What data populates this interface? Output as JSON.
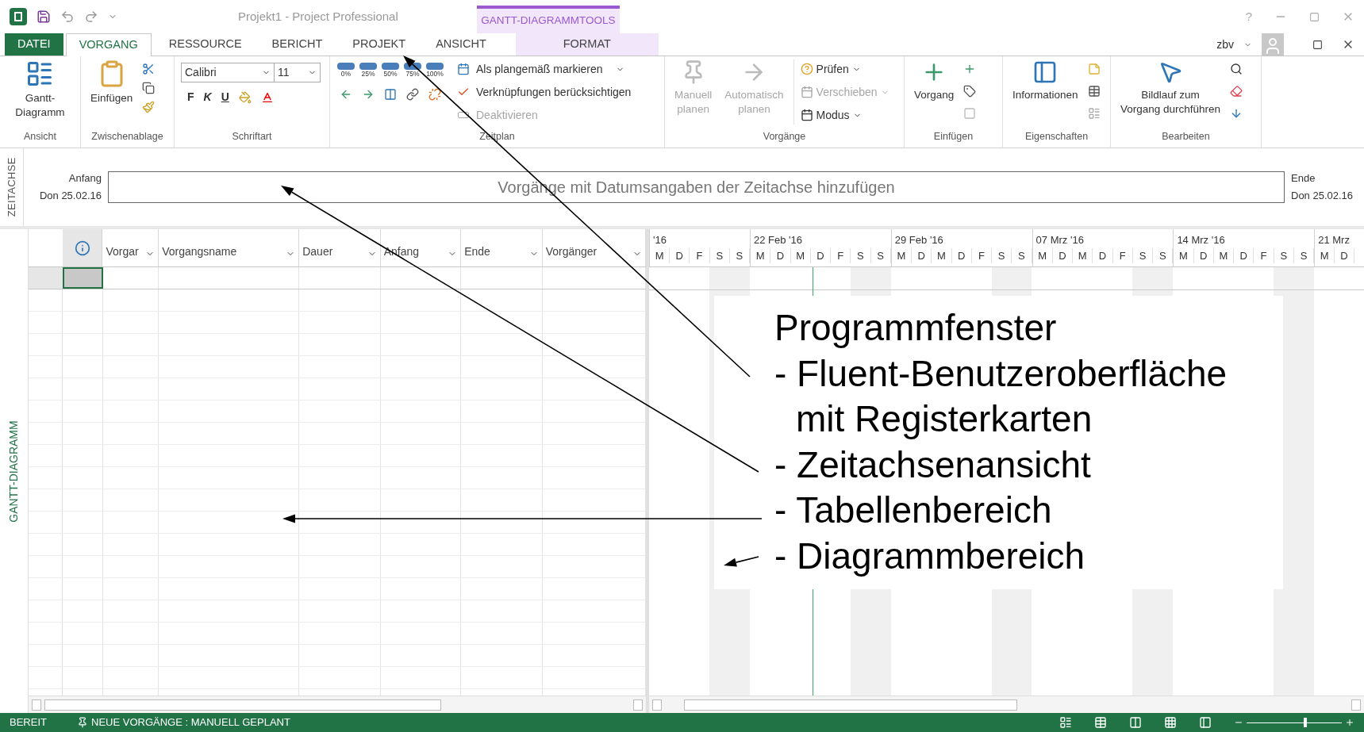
{
  "titlebar": {
    "title": "Projekt1 - Project Professional",
    "context_tab": "GANTT-DIAGRAMMTOOLS",
    "help": "?",
    "user": "zbv"
  },
  "tabs": [
    {
      "label": "DATEI",
      "kind": "file",
      "selected": false
    },
    {
      "label": "VORGANG",
      "kind": "tab",
      "selected": true
    },
    {
      "label": "RESSOURCE",
      "kind": "tab",
      "selected": false
    },
    {
      "label": "BERICHT",
      "kind": "tab",
      "selected": false
    },
    {
      "label": "PROJEKT",
      "kind": "tab",
      "selected": false
    },
    {
      "label": "ANSICHT",
      "kind": "tab",
      "selected": false
    },
    {
      "label": "FORMAT",
      "kind": "context",
      "selected": false
    }
  ],
  "ribbon": {
    "view": {
      "group": "Ansicht",
      "button": [
        "Gantt-",
        "Diagramm"
      ]
    },
    "clipboard": {
      "group": "Zwischenablage",
      "paste": "Einfügen"
    },
    "font": {
      "group": "Schriftart",
      "family": "Calibri",
      "size": "11",
      "bold": "F",
      "italic": "K",
      "underline": "U"
    },
    "schedule": {
      "group": "Zeitplan",
      "percents": [
        "0%",
        "25%",
        "50%",
        "75%",
        "100%"
      ],
      "commands": [
        {
          "label": "Als plangemäß markieren",
          "disabled": false,
          "dropdown": true
        },
        {
          "label": "Verknüpfungen berücksichtigen",
          "disabled": false,
          "dropdown": false
        },
        {
          "label": "Deaktivieren",
          "disabled": true,
          "dropdown": false
        }
      ]
    },
    "tasks": {
      "group": "Vorgänge",
      "big": [
        {
          "label": [
            "Manuell",
            "planen"
          ],
          "disabled": true
        },
        {
          "label": [
            "Automatisch",
            "planen"
          ],
          "disabled": true
        }
      ],
      "commands": [
        {
          "label": "Prüfen",
          "disabled": false
        },
        {
          "label": "Verschieben",
          "disabled": true
        },
        {
          "label": "Modus",
          "disabled": false
        }
      ]
    },
    "insert": {
      "group": "Einfügen",
      "button": "Vorgang"
    },
    "properties": {
      "group": "Eigenschaften",
      "button": "Informationen"
    },
    "editing": {
      "group": "Bearbeiten",
      "button": [
        "Bildlauf zum",
        "Vorgang durchführen"
      ]
    }
  },
  "timeline": {
    "side_label": "ZEITACHSE",
    "start_label": "Anfang",
    "start_date": "Don 25.02.16",
    "hint": "Vorgänge mit Datumsangaben der Zeitachse hinzufügen",
    "end_label": "Ende",
    "end_date": "Don 25.02.16"
  },
  "table": {
    "side_label": "GANTT-DIAGRAMM",
    "columns": [
      {
        "label": "Vorgar"
      },
      {
        "label": "Vorgangsname"
      },
      {
        "label": "Dauer"
      },
      {
        "label": "Anfang"
      },
      {
        "label": "Ende"
      },
      {
        "label": "Vorgänger"
      }
    ],
    "rows": [
      {
        "selected": true
      }
    ]
  },
  "gantt": {
    "weeks": [
      {
        "label": "'16",
        "days": [
          {
            "label": "M",
            "shaded": false
          },
          {
            "label": "D",
            "shaded": false
          },
          {
            "label": "F",
            "shaded": false
          },
          {
            "label": "S",
            "shaded": true
          },
          {
            "label": "S",
            "shaded": true
          }
        ]
      },
      {
        "label": "22 Feb '16",
        "days": [
          {
            "label": "M",
            "shaded": false
          },
          {
            "label": "D",
            "shaded": false
          },
          {
            "label": "M",
            "shaded": false
          },
          {
            "label": "D",
            "shaded": false
          },
          {
            "label": "F",
            "shaded": false
          },
          {
            "label": "S",
            "shaded": true
          },
          {
            "label": "S",
            "shaded": true
          }
        ]
      },
      {
        "label": "29 Feb '16",
        "days": [
          {
            "label": "M",
            "shaded": false
          },
          {
            "label": "D",
            "shaded": false
          },
          {
            "label": "M",
            "shaded": false
          },
          {
            "label": "D",
            "shaded": false
          },
          {
            "label": "F",
            "shaded": false
          },
          {
            "label": "S",
            "shaded": true
          },
          {
            "label": "S",
            "shaded": true
          }
        ]
      },
      {
        "label": "07 Mrz '16",
        "days": [
          {
            "label": "M",
            "shaded": false
          },
          {
            "label": "D",
            "shaded": false
          },
          {
            "label": "M",
            "shaded": false
          },
          {
            "label": "D",
            "shaded": false
          },
          {
            "label": "F",
            "shaded": false
          },
          {
            "label": "S",
            "shaded": true
          },
          {
            "label": "S",
            "shaded": true
          }
        ]
      },
      {
        "label": "14 Mrz '16",
        "days": [
          {
            "label": "M",
            "shaded": false
          },
          {
            "label": "D",
            "shaded": false
          },
          {
            "label": "M",
            "shaded": false
          },
          {
            "label": "D",
            "shaded": false
          },
          {
            "label": "F",
            "shaded": false
          },
          {
            "label": "S",
            "shaded": true
          },
          {
            "label": "S",
            "shaded": true
          }
        ]
      },
      {
        "label": "21 Mrz",
        "days": [
          {
            "label": "M",
            "shaded": false
          },
          {
            "label": "D",
            "shaded": false
          }
        ]
      }
    ]
  },
  "annotation": {
    "title": "Programmfenster",
    "items": [
      [
        "- Fluent-Benutzeroberfläche",
        "mit Registerkarten"
      ],
      [
        "- Zeitachsenansicht"
      ],
      [
        "- Tabellenbereich"
      ],
      [
        "- Diagrammbereich"
      ]
    ]
  },
  "status_bar": {
    "status": "BEREIT",
    "mode": "NEUE VORGÄNGE : MANUELL GEPLANT",
    "zoom": {
      "level": 0.62
    }
  }
}
